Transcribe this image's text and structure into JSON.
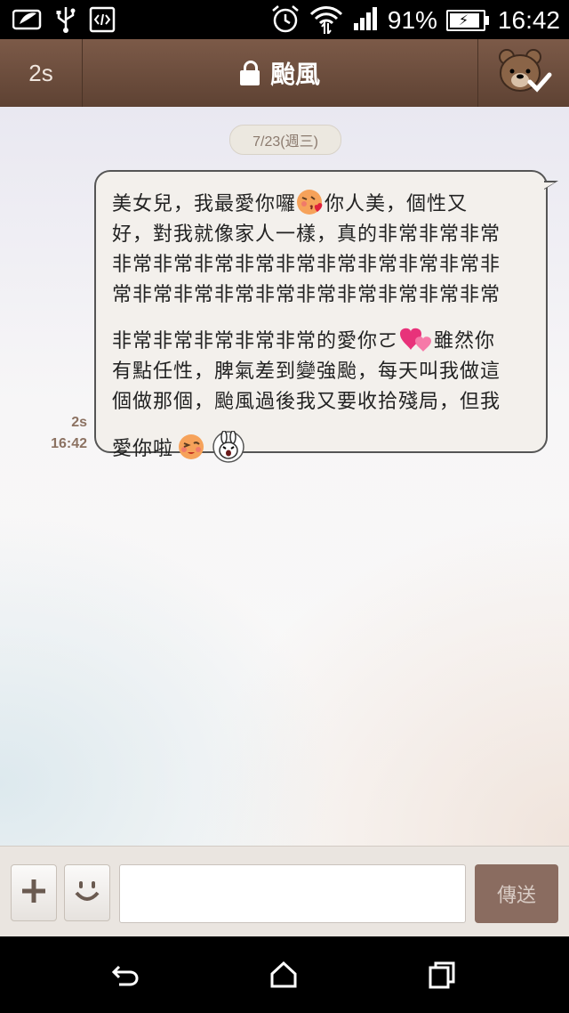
{
  "status_bar": {
    "battery_percent": "91%",
    "time": "16:42",
    "battery_level": 0.91,
    "icons": [
      "notification-icon",
      "usb-icon",
      "debug-icon",
      "alarm-icon",
      "wifi-icon",
      "signal-icon",
      "battery-icon"
    ]
  },
  "header": {
    "back_label": "2s",
    "title": "颱風",
    "lock_icon": "lock-icon",
    "right_icon": "bear-menu-icon"
  },
  "chat": {
    "date": "7/23(週三)",
    "messages": [
      {
        "read_label": "2s",
        "time": "16:42",
        "lines": [
          "美女兒，我最愛你囉",
          "你人美，個性又",
          "好，對我就像家人一樣，真的非常非常非常",
          "非常非常非常非常非常非常非常非常非常非",
          "常非常非常非常非常非常非常非常非常非常",
          "非常非常非常非常非常的愛你ㄛ",
          "雖然你",
          "有點任性，脾氣差到變強颱，每天叫我做這",
          "個做那個，颱風過後我又要收拾殘局，但我",
          "愛你啦"
        ],
        "emoticons": [
          "kiss-emoji-icon",
          "hearts-emoji-icon",
          "wink-emoji-icon",
          "bunny-sticker-icon"
        ]
      }
    ]
  },
  "input_bar": {
    "add_icon": "plus-icon",
    "emoji_icon": "smiley-icon",
    "message_value": "",
    "send_label": "傳送"
  },
  "nav_bar": {
    "icons": [
      "back-icon",
      "home-icon",
      "recents-icon"
    ]
  }
}
